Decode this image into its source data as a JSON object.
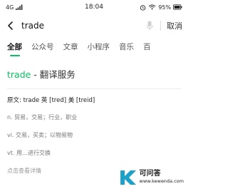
{
  "status_bar": {
    "network": "4G",
    "time": "18:04",
    "battery": "95%"
  },
  "search": {
    "query": "trade",
    "cancel_label": "取消"
  },
  "tabs": [
    {
      "label": "全部",
      "active": true
    },
    {
      "label": "公众号",
      "active": false
    },
    {
      "label": "文章",
      "active": false
    },
    {
      "label": "小程序",
      "active": false
    },
    {
      "label": "音乐",
      "active": false
    },
    {
      "label": "百",
      "active": false
    }
  ],
  "result": {
    "keyword": "trade",
    "separator": " - ",
    "service": "翻译服务",
    "pronunciation": "原文: trade  英 [tred]  美 [treid]",
    "definitions": [
      "n. 贸易，交易；行业，职业",
      "vi. 交易，买卖；以物易物",
      "vt. 用…进行交换"
    ],
    "more_label": "点击查看详情"
  },
  "watermark": {
    "name": "可问答",
    "url": "www.kewenda.com"
  },
  "colors": {
    "accent": "#07c160",
    "watermark_accent": "#1da1c8"
  }
}
